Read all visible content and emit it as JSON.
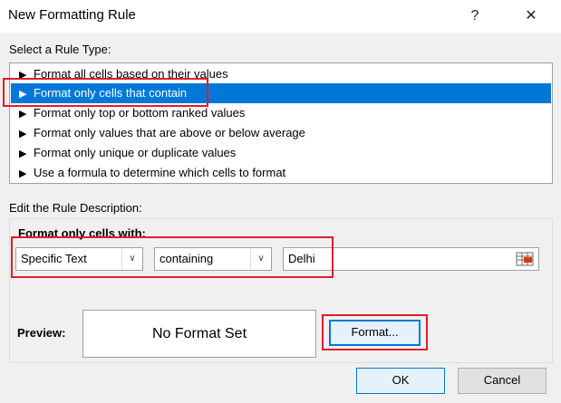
{
  "window": {
    "title": "New Formatting Rule",
    "help_glyph": "?",
    "close_glyph": "✕"
  },
  "select_rule_type": {
    "label": "Select a Rule Type:",
    "items": [
      "Format all cells based on their values",
      "Format only cells that contain",
      "Format only top or bottom ranked values",
      "Format only values that are above or below average",
      "Format only unique or duplicate values",
      "Use a formula to determine which cells to format"
    ],
    "selected_index": 1
  },
  "edit_rule": {
    "label": "Edit the Rule Description:",
    "format_cells_with": "Format only cells with:",
    "condition_type": "Specific Text",
    "operator": "containing",
    "value": "Delhi",
    "preview_label": "Preview:",
    "preview_text": "No Format Set",
    "format_button": "Format..."
  },
  "buttons": {
    "ok": "OK",
    "cancel": "Cancel"
  },
  "colors": {
    "selection": "#0078d7",
    "highlight": "#e01e2b"
  }
}
